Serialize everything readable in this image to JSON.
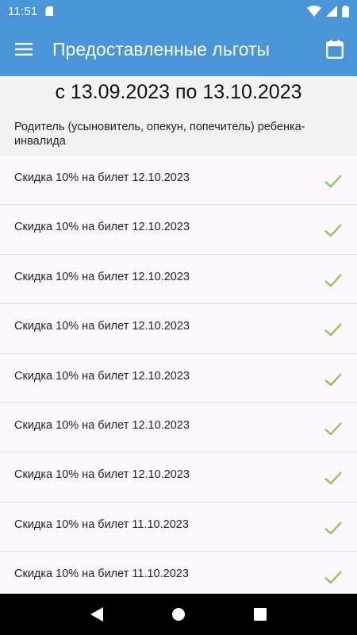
{
  "status_bar": {
    "time": "11:51",
    "icons": [
      "sd-card-icon",
      "wifi-icon",
      "cellular-icon",
      "battery-icon"
    ]
  },
  "app_bar": {
    "title": "Предоставленные льготы",
    "menu_icon": "menu-icon",
    "calendar_icon": "calendar-icon"
  },
  "period": {
    "text": "с 13.09.2023 по 13.10.2023"
  },
  "category": {
    "text": "Родитель (усыновитель, опекун, попечитель) ребенка-инвалида"
  },
  "benefits": [
    {
      "label": "Скидка 10% на билет 12.10.2023",
      "status": "check-icon"
    },
    {
      "label": "Скидка 10% на билет 12.10.2023",
      "status": "check-icon"
    },
    {
      "label": "Скидка 10% на билет 12.10.2023",
      "status": "check-icon"
    },
    {
      "label": "Скидка 10% на билет 12.10.2023",
      "status": "check-icon"
    },
    {
      "label": "Скидка 10% на билет 12.10.2023",
      "status": "check-icon"
    },
    {
      "label": "Скидка 10% на билет 12.10.2023",
      "status": "check-icon"
    },
    {
      "label": "Скидка 10% на билет 12.10.2023",
      "status": "check-icon"
    },
    {
      "label": "Скидка 10% на билет 11.10.2023",
      "status": "check-icon"
    },
    {
      "label": "Скидка 10% на билет 11.10.2023",
      "status": "check-icon"
    }
  ],
  "nav_bar": {
    "buttons": [
      "back-icon",
      "home-icon",
      "recents-icon"
    ]
  },
  "colors": {
    "primary": "#4a94d8",
    "header_bg": "#f2f2f2",
    "list_bg": "#fdf8fd",
    "check": "#8bc34a",
    "nav_bg": "#000000"
  }
}
